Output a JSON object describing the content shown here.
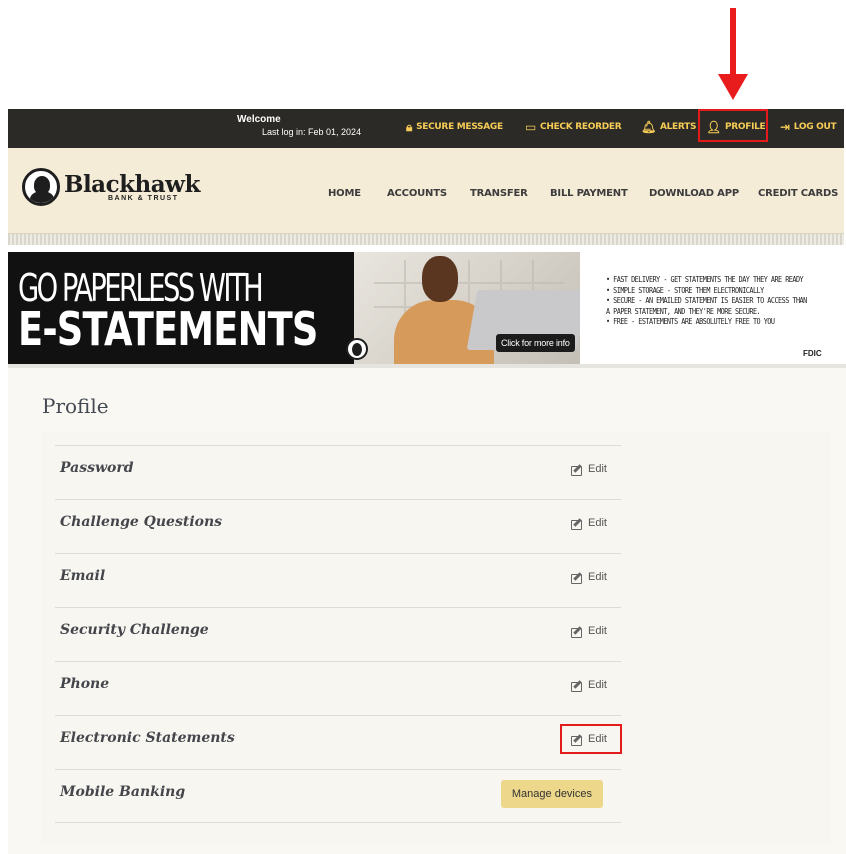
{
  "topbar": {
    "welcome": "Welcome",
    "last_login": "Last log in: Feb 01, 2024",
    "secure_message": "SECURE MESSAGE",
    "check_reorder": "CHECK REORDER",
    "alerts": "ALERTS",
    "profile": "PROFILE",
    "logout": "LOG OUT"
  },
  "brand": {
    "name": "Blackhawk",
    "tagline": "BANK & TRUST"
  },
  "nav": {
    "home": "HOME",
    "accounts": "ACCOUNTS",
    "transfer": "TRANSFER",
    "bill_payment": "BILL PAYMENT",
    "download_app": "DOWNLOAD APP",
    "credit_cards": "CREDIT CARDS"
  },
  "banner": {
    "line1": "GO PAPERLESS WITH",
    "line2": "E-STATEMENTS",
    "click_info": "Click for more info",
    "bullets": [
      "• FAST DELIVERY - GET STATEMENTS THE DAY THEY ARE READY",
      "• SIMPLE STORAGE - STORE THEM ELECTRONICALLY",
      "• SECURE - AN EMAILED STATEMENT IS EASIER TO ACCESS THAN",
      "  A PAPER STATEMENT, AND THEY'RE MORE SECURE.",
      "• FREE - ESTATEMENTS ARE ABSOLUTELY FREE TO YOU"
    ],
    "fdic": "FDIC"
  },
  "profile": {
    "title": "Profile",
    "rows": [
      {
        "label": "Password",
        "action": "Edit"
      },
      {
        "label": "Challenge Questions",
        "action": "Edit"
      },
      {
        "label": "Email",
        "action": "Edit"
      },
      {
        "label": "Security Challenge",
        "action": "Edit"
      },
      {
        "label": "Phone",
        "action": "Edit"
      },
      {
        "label": "Electronic Statements",
        "action": "Edit"
      },
      {
        "label": "Mobile Banking",
        "action": "Manage devices"
      }
    ]
  },
  "colors": {
    "topbar_bg": "#2b2a26",
    "topbar_accent": "#f6cc56",
    "header_bg": "#f5ecd8",
    "highlight": "#e21c1c",
    "button_bg": "#ecd78a"
  },
  "icons": {
    "secure_message": "lock-icon",
    "check_reorder": "check-icon",
    "alerts": "bell-icon",
    "profile": "user-icon",
    "logout": "logout-icon",
    "edit": "edit-icon"
  }
}
